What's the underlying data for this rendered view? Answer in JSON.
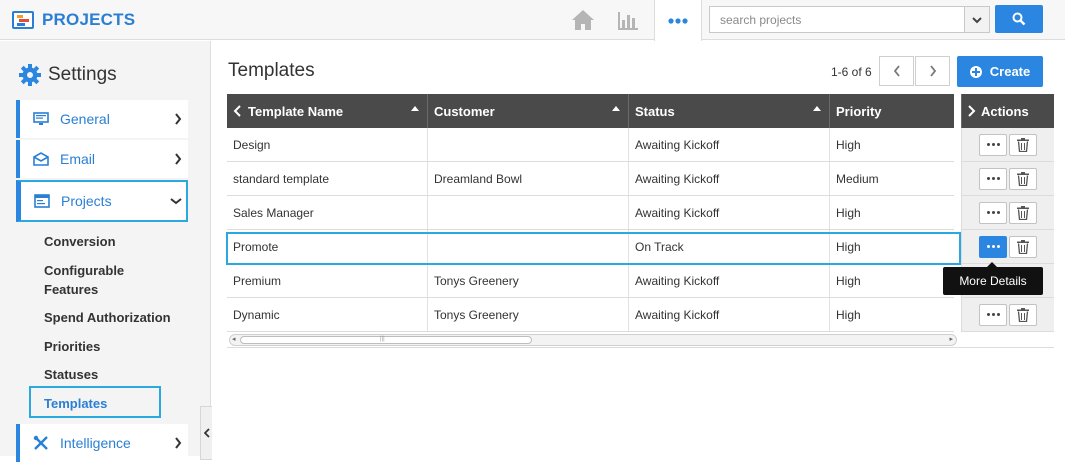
{
  "app": {
    "title": "PROJECTS"
  },
  "search": {
    "placeholder": "search projects"
  },
  "colors": {
    "accent": "#2a86e0",
    "highlight": "#2aa8df",
    "header_bg": "#4a4a4a"
  },
  "sidebar": {
    "title": "Settings",
    "items": [
      {
        "label": "General",
        "icon": "monitor-icon"
      },
      {
        "label": "Email",
        "icon": "envelope-icon"
      },
      {
        "label": "Projects",
        "icon": "projects-icon"
      },
      {
        "label": "Intelligence",
        "icon": "tools-icon"
      }
    ],
    "subitems": [
      {
        "label": "Conversion"
      },
      {
        "label": "Configurable Features"
      },
      {
        "label": "Spend Authorization"
      },
      {
        "label": "Priorities"
      },
      {
        "label": "Statuses"
      },
      {
        "label": "Templates"
      }
    ]
  },
  "main": {
    "title": "Templates",
    "pager": "1-6 of 6",
    "create_label": "Create",
    "columns": [
      "Template Name",
      "Customer",
      "Status",
      "Priority"
    ],
    "actions_label": "Actions",
    "rows": [
      {
        "name": "Design",
        "customer": "",
        "status": "Awaiting Kickoff",
        "priority": "High"
      },
      {
        "name": "standard template",
        "customer": "Dreamland Bowl",
        "status": "Awaiting Kickoff",
        "priority": "Medium"
      },
      {
        "name": "Sales Manager",
        "customer": "",
        "status": "Awaiting Kickoff",
        "priority": "High"
      },
      {
        "name": "Promote",
        "customer": "",
        "status": "On Track",
        "priority": "High"
      },
      {
        "name": "Premium",
        "customer": "Tonys Greenery",
        "status": "Awaiting Kickoff",
        "priority": "High"
      },
      {
        "name": "Dynamic",
        "customer": "Tonys Greenery",
        "status": "Awaiting Kickoff",
        "priority": "High"
      }
    ],
    "tooltip": "More Details"
  }
}
